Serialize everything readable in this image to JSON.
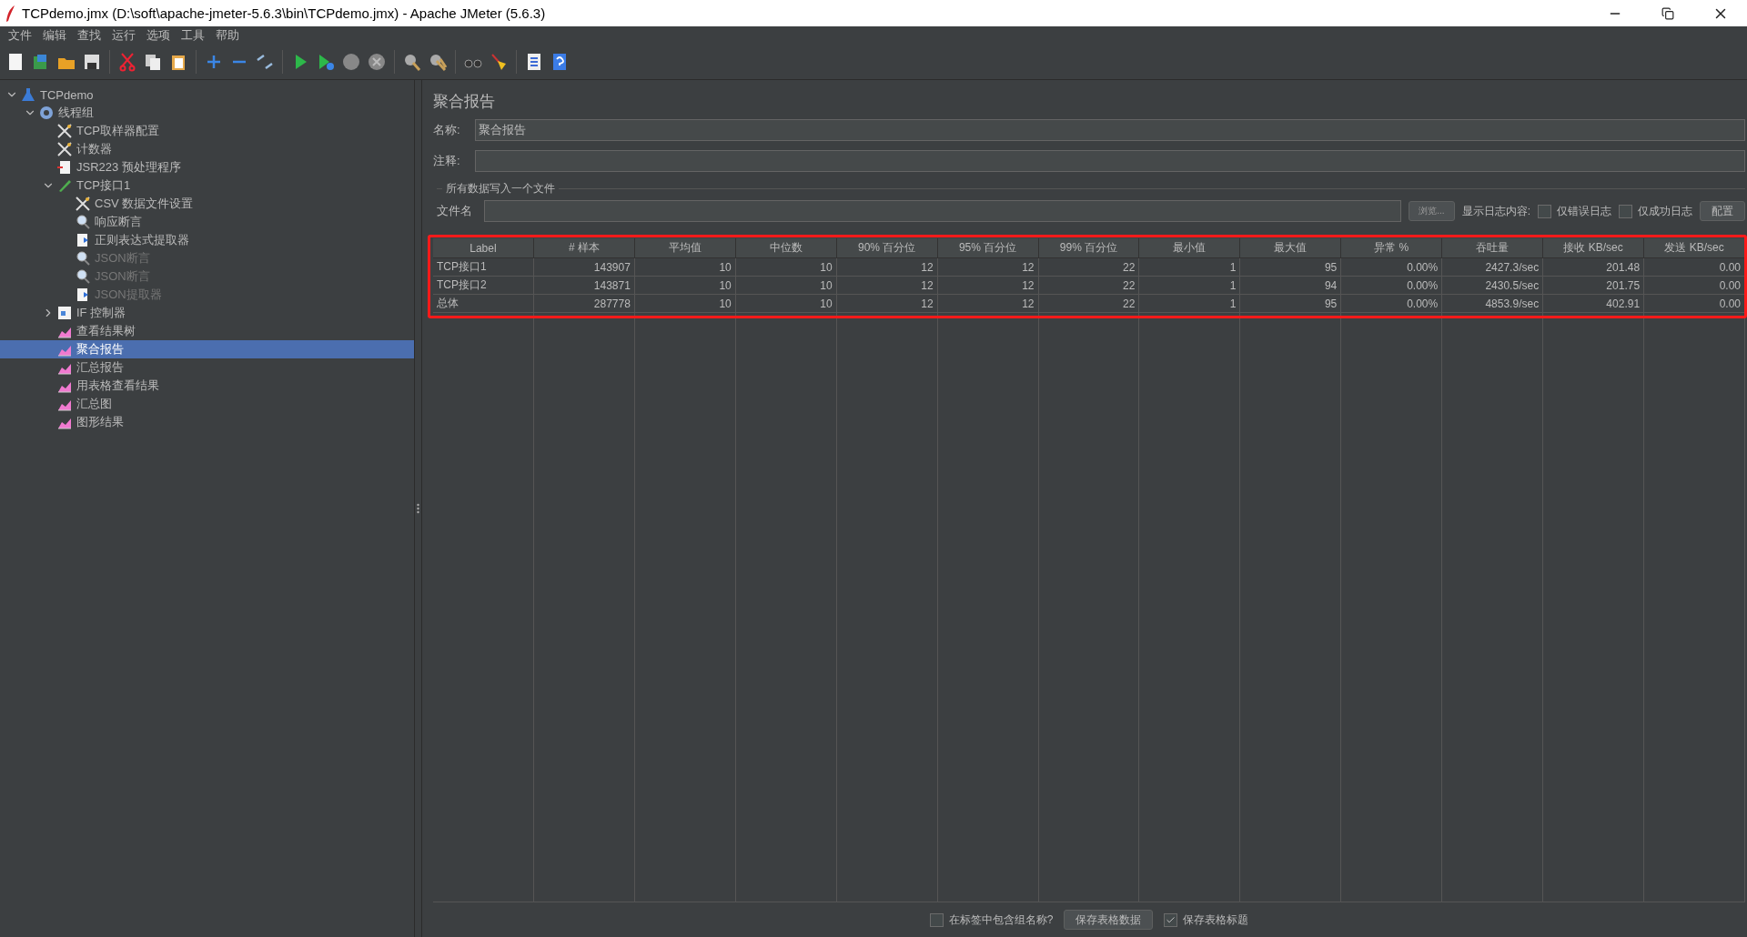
{
  "window": {
    "title": "TCPdemo.jmx (D:\\soft\\apache-jmeter-5.6.3\\bin\\TCPdemo.jmx) - Apache JMeter (5.6.3)"
  },
  "menu": [
    "文件",
    "编辑",
    "查找",
    "运行",
    "选项",
    "工具",
    "帮助"
  ],
  "tree": [
    {
      "label": "TCPdemo",
      "kind": "plan",
      "expanded": true,
      "selected": false,
      "disabled": false,
      "children": [
        {
          "label": "线程组",
          "kind": "threads",
          "expanded": true,
          "selected": false,
          "disabled": false,
          "children": [
            {
              "label": "TCP取样器配置",
              "kind": "config",
              "selected": false,
              "disabled": false
            },
            {
              "label": "计数器",
              "kind": "config",
              "selected": false,
              "disabled": false
            },
            {
              "label": "JSR223 预处理程序",
              "kind": "script",
              "selected": false,
              "disabled": false
            },
            {
              "label": "TCP接口1",
              "kind": "sampler",
              "expanded": true,
              "selected": false,
              "disabled": false,
              "children": [
                {
                  "label": "CSV 数据文件设置",
                  "kind": "config",
                  "selected": false,
                  "disabled": false
                },
                {
                  "label": "响应断言",
                  "kind": "assertion",
                  "selected": false,
                  "disabled": false
                },
                {
                  "label": "正则表达式提取器",
                  "kind": "extractor",
                  "selected": false,
                  "disabled": false
                },
                {
                  "label": "JSON断言",
                  "kind": "assertion",
                  "selected": false,
                  "disabled": true
                },
                {
                  "label": "JSON断言",
                  "kind": "assertion",
                  "selected": false,
                  "disabled": true
                },
                {
                  "label": "JSON提取器",
                  "kind": "extractor",
                  "selected": false,
                  "disabled": true
                }
              ]
            },
            {
              "label": "IF 控制器",
              "kind": "controller",
              "expanded": false,
              "selected": false,
              "disabled": false
            },
            {
              "label": "查看结果树",
              "kind": "listener",
              "selected": false,
              "disabled": false
            },
            {
              "label": "聚合报告",
              "kind": "listener",
              "selected": true,
              "disabled": false
            },
            {
              "label": "汇总报告",
              "kind": "listener",
              "selected": false,
              "disabled": false
            },
            {
              "label": "用表格查看结果",
              "kind": "listener",
              "selected": false,
              "disabled": false
            },
            {
              "label": "汇总图",
              "kind": "listener",
              "selected": false,
              "disabled": false
            },
            {
              "label": "图形结果",
              "kind": "listener",
              "selected": false,
              "disabled": false
            }
          ]
        }
      ]
    }
  ],
  "panel": {
    "title": "聚合报告",
    "name_label": "名称:",
    "name_value": "聚合报告",
    "comment_label": "注释:",
    "group_title": "所有数据写入一个文件",
    "file_label": "文件名",
    "browse_button": "浏览...",
    "log_label": "显示日志内容:",
    "log_options": [
      {
        "label": "仅错误日志",
        "checked": false
      },
      {
        "label": "仅成功日志",
        "checked": false
      }
    ],
    "config_button": "配置"
  },
  "table": {
    "highlighted": true,
    "columns": [
      "Label",
      "# 样本",
      "平均值",
      "中位数",
      "90% 百分位",
      "95% 百分位",
      "99% 百分位",
      "最小值",
      "最大值",
      "异常 %",
      "吞吐量",
      "接收 KB/sec",
      "发送 KB/sec"
    ],
    "rows": [
      [
        "TCP接口1",
        "143907",
        "10",
        "10",
        "12",
        "12",
        "22",
        "1",
        "95",
        "0.00%",
        "2427.3/sec",
        "201.48",
        "0.00"
      ],
      [
        "TCP接口2",
        "143871",
        "10",
        "10",
        "12",
        "12",
        "22",
        "1",
        "94",
        "0.00%",
        "2430.5/sec",
        "201.75",
        "0.00"
      ],
      [
        "总体",
        "287778",
        "10",
        "10",
        "12",
        "12",
        "22",
        "1",
        "95",
        "0.00%",
        "4853.9/sec",
        "402.91",
        "0.00"
      ]
    ]
  },
  "footer": {
    "group_name": {
      "label": "在标签中包含组名称?",
      "checked": false
    },
    "save_button": "保存表格数据",
    "save_header": {
      "label": "保存表格标题",
      "checked": true
    }
  }
}
